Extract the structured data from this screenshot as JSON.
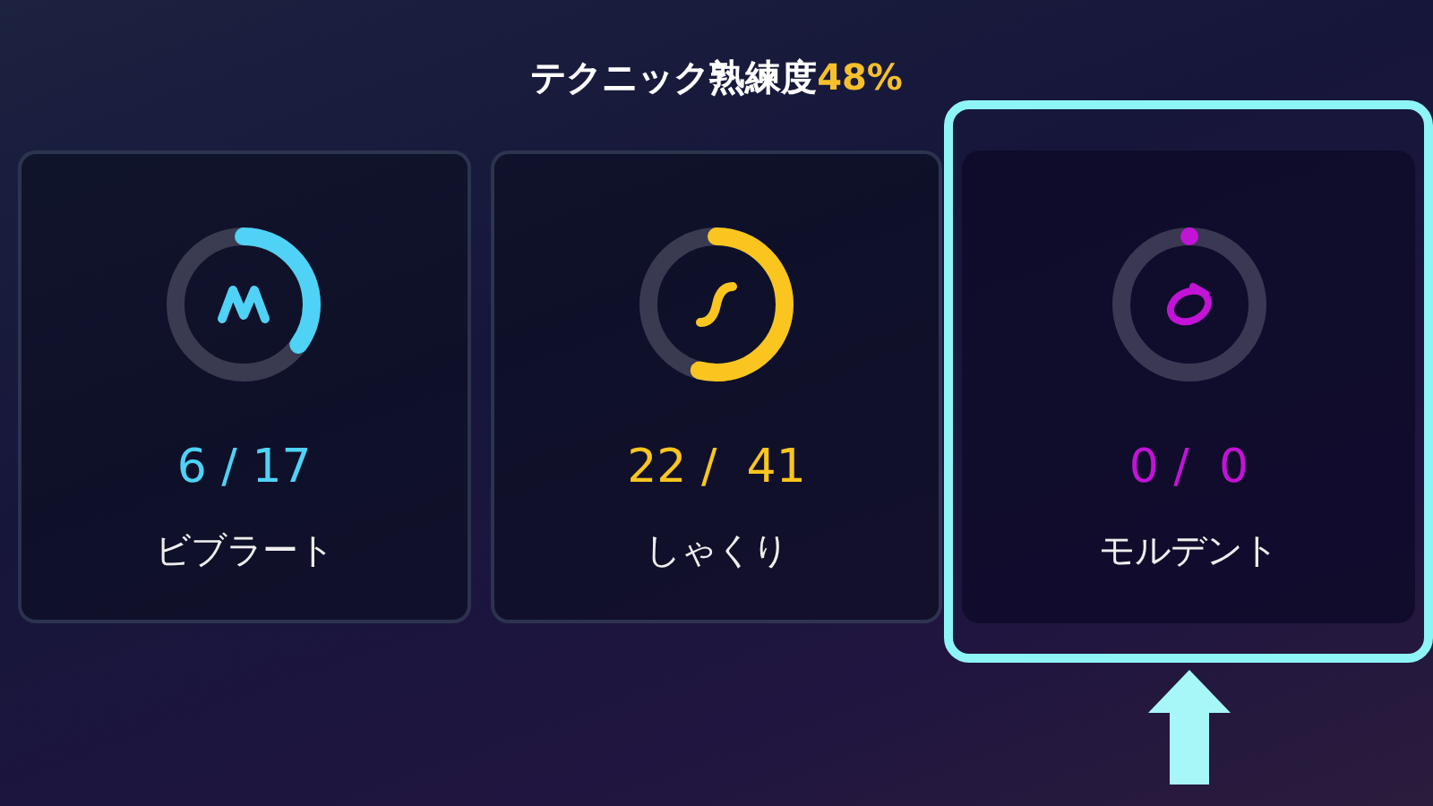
{
  "title": {
    "label": "テクニック熟練度",
    "value": "48%"
  },
  "cards": [
    {
      "kind": "vibrato",
      "count": "6 / 17",
      "name": "ビブラート",
      "level": 0.35,
      "color": "#4fd2f5",
      "highlighted": false
    },
    {
      "kind": "shakuri",
      "count": "22 /  41",
      "name": "しゃくり",
      "level": 0.54,
      "color": "#fac51e",
      "highlighted": false
    },
    {
      "kind": "mordent",
      "count": "0 /  0",
      "name": "モルデント",
      "level": 0,
      "color": "#c313d6",
      "highlighted": true
    }
  ]
}
